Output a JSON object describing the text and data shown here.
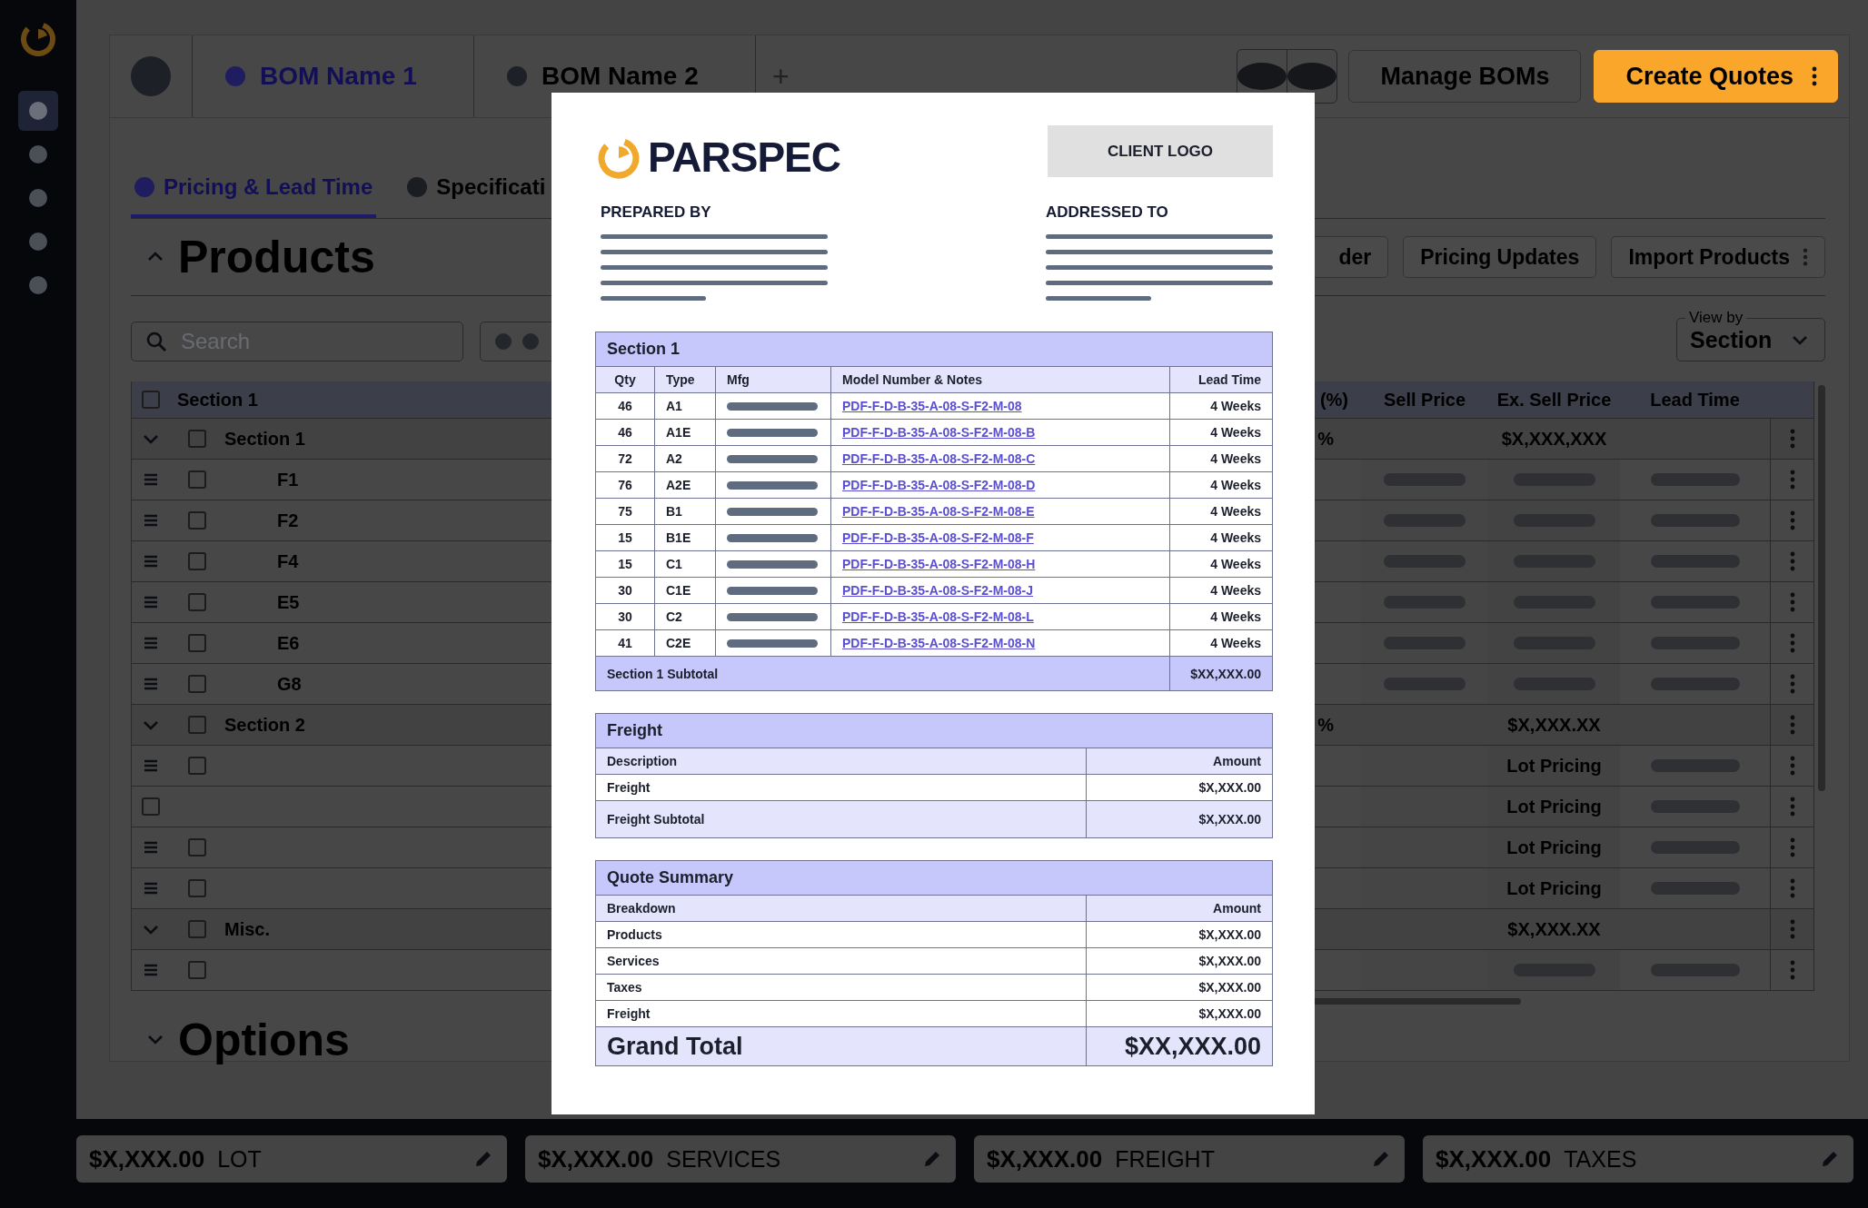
{
  "sidebar": {
    "items": [
      {
        "selected": true
      },
      {
        "selected": false
      },
      {
        "selected": false
      },
      {
        "selected": false
      },
      {
        "selected": false
      }
    ]
  },
  "bom_tabs": [
    {
      "label": "BOM Name 1",
      "selected": true
    },
    {
      "label": "BOM Name 2",
      "selected": false
    }
  ],
  "add_tab": "+",
  "header_buttons": {
    "manage": "Manage BOMs",
    "create": "Create Quotes"
  },
  "section_tabs": [
    {
      "label": "Pricing & Lead Time",
      "selected": true
    },
    {
      "label": "Specificati",
      "selected": false
    }
  ],
  "products": {
    "title": "Products",
    "expanded": true,
    "toolbar": [
      "der",
      "Pricing Updates",
      "Import Products"
    ],
    "search": {
      "placeholder": "Search"
    },
    "view_by": {
      "label": "View by",
      "value": "Section"
    },
    "table": {
      "header_checked": false,
      "columns": {
        "name": "Section 1",
        "column_4": "(%)",
        "sell_price": "Sell Price",
        "ex_sell_price": "Ex. Sell Price",
        "lead_time": "Lead Time"
      },
      "rows": [
        {
          "kind": "section",
          "name": "Section 1",
          "expanded": true,
          "checked": false,
          "column_4": "%",
          "ex_sell_price": "$X,XXX,XXX"
        },
        {
          "kind": "item",
          "type": "F1",
          "checked": false,
          "draggable": true,
          "sell_loading": true,
          "ex_sell_loading": true,
          "lead_loading": true
        },
        {
          "kind": "item",
          "type": "F2",
          "checked": false,
          "draggable": true,
          "sell_loading": true,
          "ex_sell_loading": true,
          "lead_loading": true
        },
        {
          "kind": "item",
          "type": "F4",
          "checked": false,
          "draggable": true,
          "sell_loading": true,
          "ex_sell_loading": true,
          "lead_loading": true
        },
        {
          "kind": "item",
          "type": "E5",
          "checked": false,
          "draggable": true,
          "sell_loading": true,
          "ex_sell_loading": true,
          "lead_loading": true
        },
        {
          "kind": "item",
          "type": "E6",
          "checked": false,
          "draggable": true,
          "sell_loading": true,
          "ex_sell_loading": true,
          "lead_loading": true
        },
        {
          "kind": "item",
          "type": "G8",
          "checked": false,
          "draggable": true,
          "sell_loading": true,
          "ex_sell_loading": true,
          "lead_loading": true
        },
        {
          "kind": "section",
          "name": "Section 2",
          "expanded": true,
          "checked": false,
          "column_4": "%",
          "ex_sell_price": "$X,XXX.XX"
        },
        {
          "kind": "item",
          "checked": false,
          "draggable": true,
          "sell_loading": false,
          "ex_sell_price": "Lot Pricing",
          "lead_loading": true
        },
        {
          "kind": "item",
          "checked": false,
          "draggable": false,
          "sell_loading": false,
          "ex_sell_price": "Lot Pricing",
          "lead_loading": true
        },
        {
          "kind": "item",
          "checked": false,
          "draggable": true,
          "sell_loading": false,
          "ex_sell_price": "Lot Pricing",
          "lead_loading": true
        },
        {
          "kind": "item",
          "checked": false,
          "draggable": true,
          "sell_loading": false,
          "ex_sell_price": "Lot Pricing",
          "lead_loading": true
        },
        {
          "kind": "section",
          "name": "Misc.",
          "expanded": true,
          "checked": false,
          "ex_sell_price": "$X,XXX.XX"
        },
        {
          "kind": "item",
          "checked": false,
          "draggable": true,
          "sell_loading": false,
          "ex_sell_loading": true,
          "lead_loading": true
        }
      ]
    }
  },
  "options": {
    "title": "Options",
    "expanded": false
  },
  "totals": [
    {
      "amount": "$X,XXX.00",
      "label": "LOT"
    },
    {
      "amount": "$X,XXX.00",
      "label": "SERVICES"
    },
    {
      "amount": "$X,XXX.00",
      "label": "FREIGHT"
    },
    {
      "amount": "$X,XXX.00",
      "label": "TAXES"
    }
  ],
  "quote_preview": {
    "brand": "PARSPEC",
    "client_logo": "CLIENT LOGO",
    "prepared_by": "PREPARED BY",
    "addressed_to": "ADDRESSED TO",
    "section": {
      "title": "Section 1",
      "columns": [
        "Qty",
        "Type",
        "Mfg",
        "Model Number & Notes",
        "Lead Time"
      ],
      "rows": [
        {
          "qty": "46",
          "type": "A1",
          "model": "PDF-F-D-B-35-A-08-S-F2-M-08",
          "lead_time": "4 Weeks"
        },
        {
          "qty": "46",
          "type": "A1E",
          "model": "PDF-F-D-B-35-A-08-S-F2-M-08-B",
          "lead_time": "4 Weeks"
        },
        {
          "qty": "72",
          "type": "A2",
          "model": "PDF-F-D-B-35-A-08-S-F2-M-08-C",
          "lead_time": "4 Weeks"
        },
        {
          "qty": "76",
          "type": "A2E",
          "model": "PDF-F-D-B-35-A-08-S-F2-M-08-D",
          "lead_time": "4 Weeks"
        },
        {
          "qty": "75",
          "type": "B1",
          "model": "PDF-F-D-B-35-A-08-S-F2-M-08-E",
          "lead_time": "4 Weeks"
        },
        {
          "qty": "15",
          "type": "B1E",
          "model": "PDF-F-D-B-35-A-08-S-F2-M-08-F",
          "lead_time": "4 Weeks"
        },
        {
          "qty": "15",
          "type": "C1",
          "model": "PDF-F-D-B-35-A-08-S-F2-M-08-H",
          "lead_time": "4 Weeks"
        },
        {
          "qty": "30",
          "type": "C1E",
          "model": "PDF-F-D-B-35-A-08-S-F2-M-08-J",
          "lead_time": "4 Weeks"
        },
        {
          "qty": "30",
          "type": "C2",
          "model": "PDF-F-D-B-35-A-08-S-F2-M-08-L",
          "lead_time": "4 Weeks"
        },
        {
          "qty": "41",
          "type": "C2E",
          "model": "PDF-F-D-B-35-A-08-S-F2-M-08-N",
          "lead_time": "4 Weeks"
        }
      ],
      "subtotal_label": "Section 1 Subtotal",
      "subtotal": "$XX,XXX.00"
    },
    "freight": {
      "title": "Freight",
      "columns": [
        "Description",
        "Amount"
      ],
      "rows": [
        {
          "label": "Freight",
          "amount": "$X,XXX.00"
        }
      ],
      "subtotal_label": "Freight Subtotal",
      "subtotal": "$X,XXX.00"
    },
    "summary": {
      "title": "Quote Summary",
      "columns": [
        "Breakdown",
        "Amount"
      ],
      "rows": [
        {
          "label": "Products",
          "amount": "$X,XXX.00"
        },
        {
          "label": "Services",
          "amount": "$X,XXX.00"
        },
        {
          "label": "Taxes",
          "amount": "$X,XXX.00"
        },
        {
          "label": "Freight",
          "amount": "$X,XXX.00"
        }
      ],
      "total_label": "Grand Total",
      "total": "$XX,XXX.00"
    }
  }
}
